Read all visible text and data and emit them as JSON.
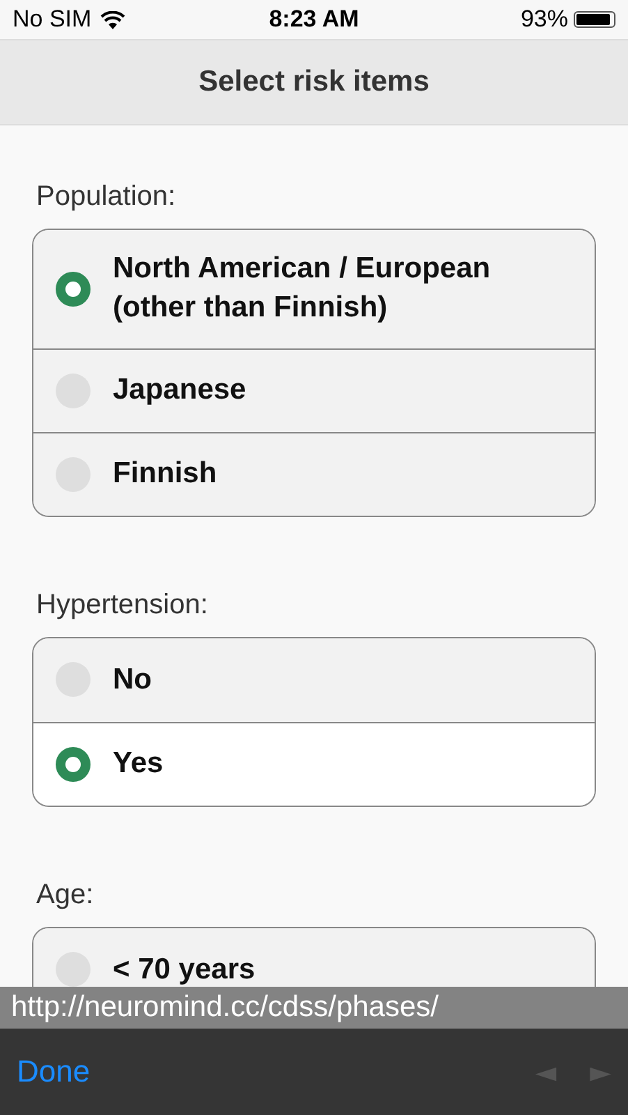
{
  "status_bar": {
    "carrier": "No SIM",
    "time": "8:23 AM",
    "battery": "93%"
  },
  "header": {
    "title": "Select risk items"
  },
  "groups": [
    {
      "label": "Population:",
      "options": [
        {
          "label": "North American / European\n(other than Finnish)",
          "selected": true,
          "focused": false
        },
        {
          "label": "Japanese",
          "selected": false,
          "focused": false
        },
        {
          "label": "Finnish",
          "selected": false,
          "focused": false
        }
      ]
    },
    {
      "label": "Hypertension:",
      "options": [
        {
          "label": "No",
          "selected": false,
          "focused": false
        },
        {
          "label": "Yes",
          "selected": true,
          "focused": true
        }
      ]
    },
    {
      "label": "Age:",
      "options": [
        {
          "label": "< 70 years",
          "selected": false,
          "focused": false
        }
      ]
    }
  ],
  "url_bar": {
    "url": "http://neuromind.cc/cdss/phases/"
  },
  "toolbar": {
    "done": "Done",
    "previous": "◄",
    "next": "►"
  }
}
